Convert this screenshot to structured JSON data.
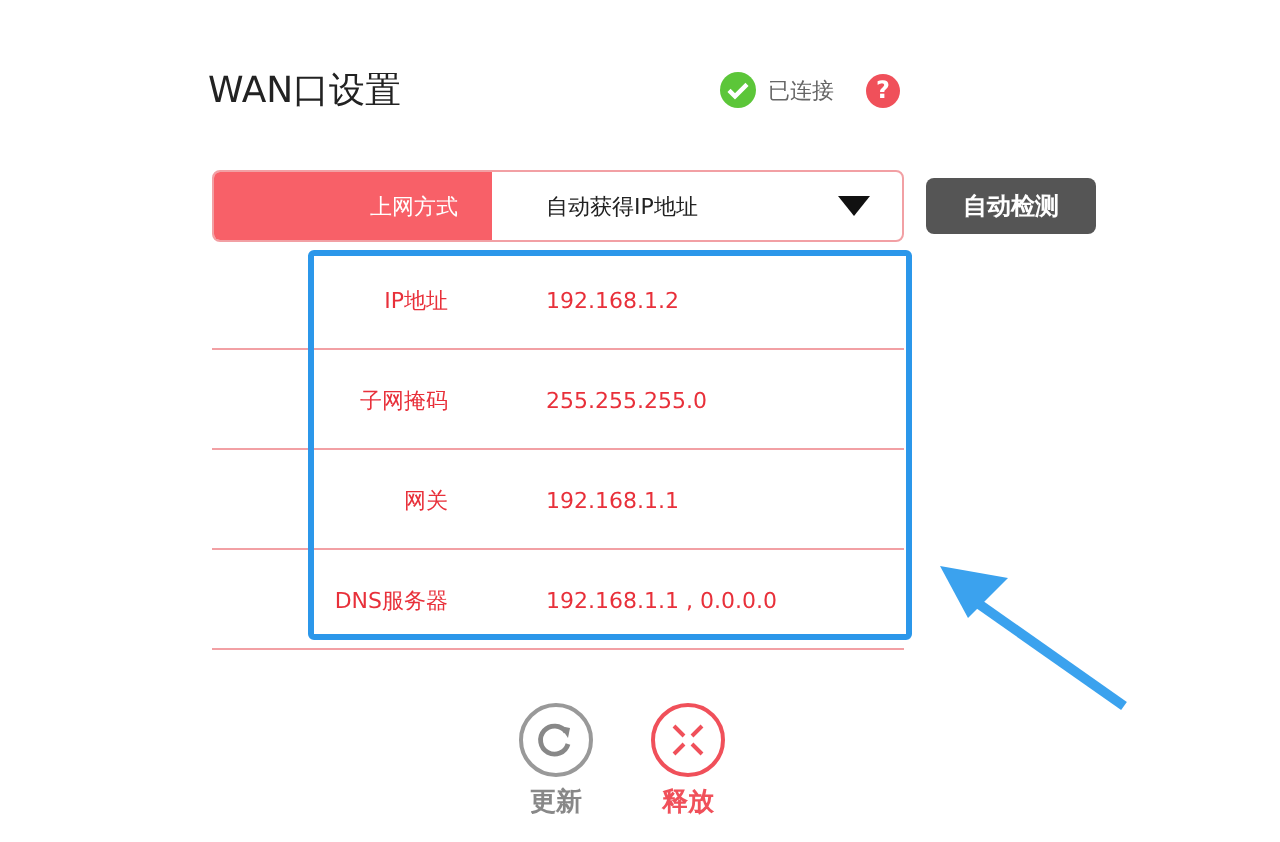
{
  "page": {
    "title": "WAN口设置",
    "status": "已连接",
    "help": "?"
  },
  "connection": {
    "label": "上网方式",
    "value": "自动获得IP地址",
    "detect_button": "自动检测"
  },
  "fields": [
    {
      "label": "IP地址",
      "value": "192.168.1.2"
    },
    {
      "label": "子网掩码",
      "value": "255.255.255.0"
    },
    {
      "label": "网关",
      "value": "192.168.1.1"
    },
    {
      "label": "DNS服务器",
      "value": "192.168.1.1 , 0.0.0.0"
    }
  ],
  "actions": [
    {
      "kind": "renew",
      "label": "更新"
    },
    {
      "kind": "release",
      "label": "释放"
    }
  ]
}
